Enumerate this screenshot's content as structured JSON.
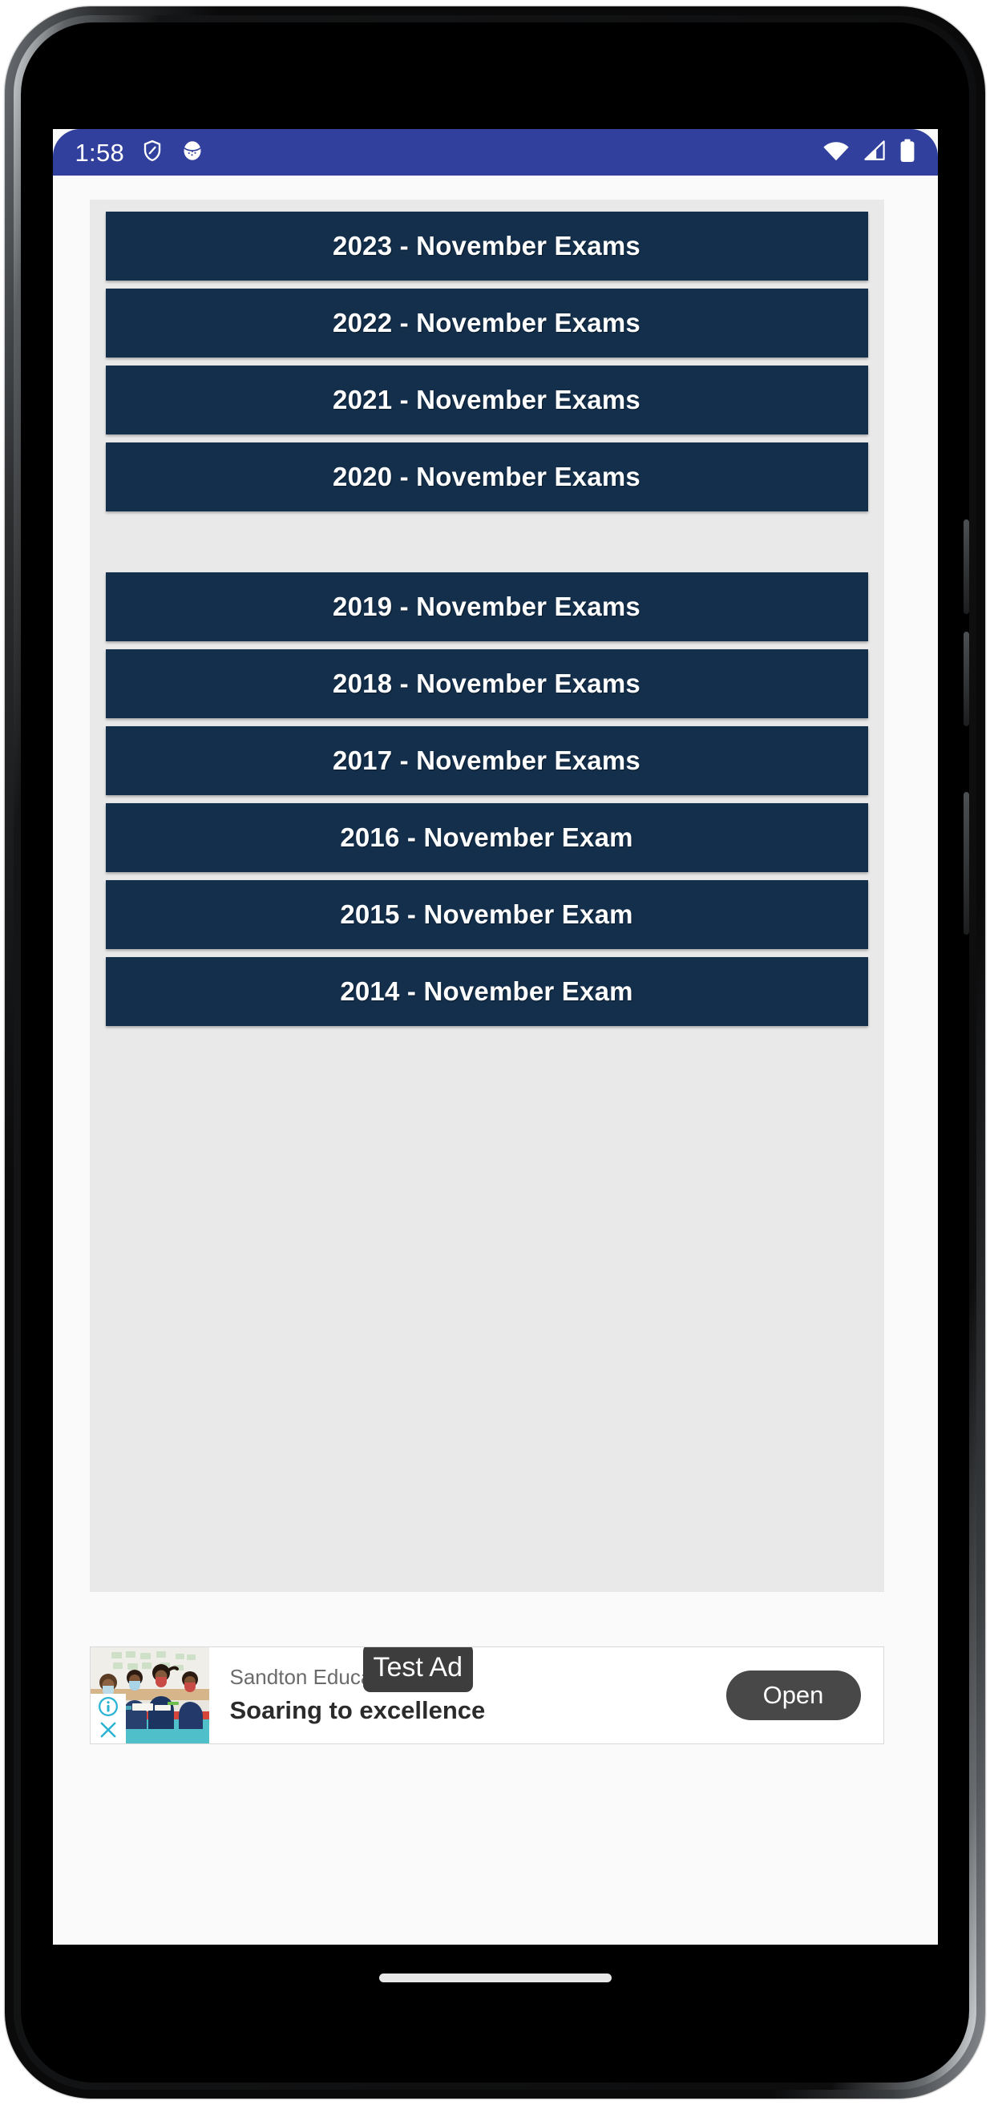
{
  "status_bar": {
    "time": "1:58",
    "left_icons": [
      "shield-icon",
      "browser-icon"
    ],
    "right_icons": [
      "wifi-icon",
      "cellular-signal-icon",
      "battery-icon"
    ],
    "background_color": "#31409d",
    "text_color": "#ffffff"
  },
  "theme": {
    "button_background": "#132f4c",
    "button_text": "#ffffff",
    "panel_background": "#e9e9e9",
    "page_background": "#fafafa"
  },
  "exam_list": {
    "items": [
      {
        "label": "2023 - November Exams",
        "year": "2023",
        "extra_gap_below": false
      },
      {
        "label": "2022 - November Exams",
        "year": "2022",
        "extra_gap_below": false
      },
      {
        "label": "2021 - November Exams",
        "year": "2021",
        "extra_gap_below": false
      },
      {
        "label": "2020 - November Exams",
        "year": "2020",
        "extra_gap_below": true
      },
      {
        "label": "2019 - November Exams",
        "year": "2019",
        "extra_gap_below": false
      },
      {
        "label": "2018 - November Exams",
        "year": "2018",
        "extra_gap_below": false
      },
      {
        "label": "2017 - November Exams",
        "year": "2017",
        "extra_gap_below": false
      },
      {
        "label": "2016 - November Exam",
        "year": "2016",
        "extra_gap_below": false
      },
      {
        "label": "2015 - November Exam",
        "year": "2015",
        "extra_gap_below": false
      },
      {
        "label": "2014 - November Exam",
        "year": "2014",
        "extra_gap_below": false
      }
    ]
  },
  "ad": {
    "test_badge": "Test Ad",
    "advertiser": "Sandton Education Group",
    "headline": "Soaring to excellence",
    "cta_label": "Open",
    "info_icon": "ad-info-icon",
    "close_icon": "ad-close-icon",
    "thumbnail_alt": "classroom-photo"
  },
  "navigation": {
    "gesture_bar": "home-gesture-bar"
  }
}
